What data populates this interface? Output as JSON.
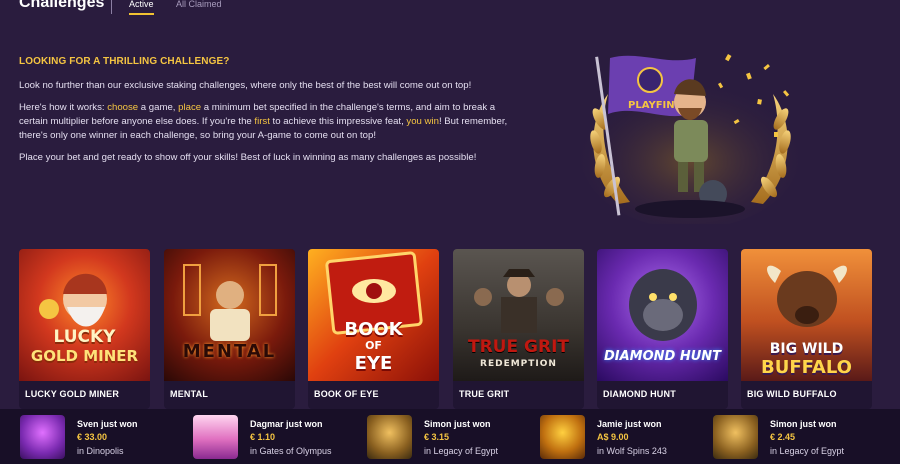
{
  "header": {
    "title": "Challenges",
    "tabs": [
      {
        "label": "Active",
        "active": true
      },
      {
        "label": "All Claimed",
        "active": false
      }
    ]
  },
  "intro": {
    "heading": "LOOKING FOR A THRILLING CHALLENGE?",
    "p1": "Look no further than our exclusive staking challenges, where only the best of the best will come out on top!",
    "p2": {
      "a": "Here's how it works: ",
      "choose": "choose",
      "b": " a game, ",
      "place": "place",
      "c": " a minimum bet specified in the challenge's terms, and aim to break a certain multiplier before anyone else does. If you're the ",
      "first": "first",
      "d": " to achieve this impressive feat, ",
      "youwin": "you win",
      "e": "! But remember, there's only one winner in each challenge, so bring your A-game to come out on top!"
    },
    "p3": "Place your bet and get ready to show off your skills! Best of luck in winning as many challenges as possible!"
  },
  "hero": {
    "flag_text": "PLAYFIN"
  },
  "cards": [
    {
      "name": "LUCKY GOLD MINER",
      "art_text": [
        "LUCKY",
        "GOLD MINER"
      ]
    },
    {
      "name": "MENTAL",
      "art_text": [
        "MENTAL"
      ]
    },
    {
      "name": "BOOK OF EYE",
      "art_text": [
        "BOOK",
        "OF",
        "EYE"
      ]
    },
    {
      "name": "TRUE GRIT",
      "art_text": [
        "TRUE GRIT",
        "REDEMPTION"
      ]
    },
    {
      "name": "DIAMOND HUNT",
      "art_text": [
        "DIAMOND HUNT"
      ]
    },
    {
      "name": "BIG WILD BUFFALO",
      "art_text": [
        "BIG WILD",
        "BUFFALO"
      ]
    }
  ],
  "wins": [
    {
      "who": "Sven just won",
      "amount": "€ 33.00",
      "game": "in Dinopolis"
    },
    {
      "who": "Dagmar just won",
      "amount": "€ 1.10",
      "game": "in Gates of Olympus"
    },
    {
      "who": "Simon just won",
      "amount": "€ 3.15",
      "game": "in Legacy of Egypt"
    },
    {
      "who": "Jamie just won",
      "amount": "A$ 9.00",
      "game": "in Wolf Spins 243"
    },
    {
      "who": "Simon just won",
      "amount": "€ 2.45",
      "game": "in Legacy of Egypt"
    }
  ],
  "colors": {
    "accent": "#f5c542",
    "background": "#2a1c3e"
  }
}
